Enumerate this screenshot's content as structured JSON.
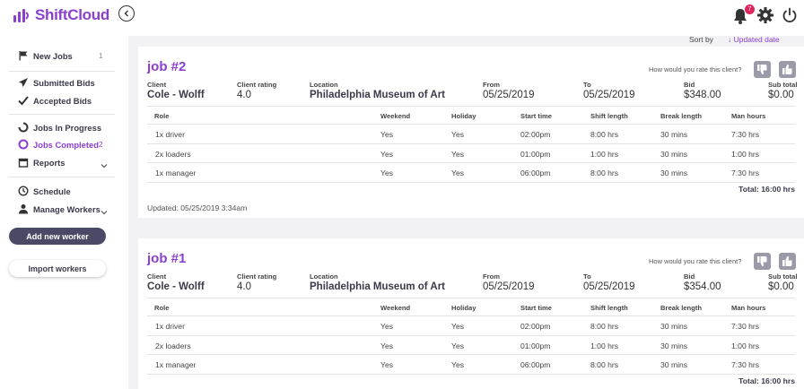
{
  "app": {
    "name": "ShiftCloud",
    "notification_count": "7",
    "brand_color": "#8a3fd1"
  },
  "sidebar": {
    "items": [
      {
        "label": "New Jobs",
        "count": "1"
      },
      {
        "label": "Submitted Bids"
      },
      {
        "label": "Accepted Bids"
      },
      {
        "label": "Jobs In Progress"
      },
      {
        "label": "Jobs Completed",
        "count": "2"
      },
      {
        "label": "Reports"
      },
      {
        "label": "Schedule"
      },
      {
        "label": "Manage Workers"
      }
    ],
    "add_worker_label": "Add new worker",
    "import_workers_label": "Import workers"
  },
  "sort": {
    "label": "Sort by",
    "value": "↓ Updated date"
  },
  "labels": {
    "client": "Client",
    "client_rating": "Client rating",
    "location": "Location",
    "from": "From",
    "to": "To",
    "bid": "Bid",
    "sub_total": "Sub total",
    "rate_question": "How would you rate this client?"
  },
  "table_headers": [
    "Role",
    "Weekend",
    "Holiday",
    "Start time",
    "Shift length",
    "Break length",
    "Man hours"
  ],
  "jobs": [
    {
      "title": "job #2",
      "client": "Cole - Wolff",
      "rating": "4.0",
      "location": "Philadelphia Museum of Art",
      "from": "05/25/2019",
      "to": "05/25/2019",
      "bid": "$348.00",
      "sub_total": "$0.00",
      "rows": [
        [
          "1x driver",
          "Yes",
          "Yes",
          "02:00pm",
          "8:00 hrs",
          "30 mins",
          "7:30 hrs"
        ],
        [
          "2x loaders",
          "Yes",
          "Yes",
          "01:00pm",
          "1:00 hrs",
          "30 mins",
          "1:00 hrs"
        ],
        [
          "1x manager",
          "Yes",
          "Yes",
          "06:00pm",
          "8:00 hrs",
          "30 mins",
          "7:30 hrs"
        ]
      ],
      "total": "Total: 16:00 hrs",
      "updated": "Updated: 05/25/2019 3:34am"
    },
    {
      "title": "job #1",
      "client": "Cole - Wolff",
      "rating": "4.0",
      "location": "Philadelphia Museum of Art",
      "from": "05/25/2019",
      "to": "05/25/2019",
      "bid": "$354.00",
      "sub_total": "$0.00",
      "rows": [
        [
          "1x driver",
          "Yes",
          "Yes",
          "02:00pm",
          "8:00 hrs",
          "30 mins",
          "7:30 hrs"
        ],
        [
          "2x loaders",
          "Yes",
          "Yes",
          "01:00pm",
          "1:00 hrs",
          "30 mins",
          "1:00 hrs"
        ],
        [
          "1x manager",
          "Yes",
          "Yes",
          "06:00pm",
          "8:00 hrs",
          "30 mins",
          "7:30 hrs"
        ]
      ],
      "total": "Total: 16:00 hrs"
    }
  ]
}
